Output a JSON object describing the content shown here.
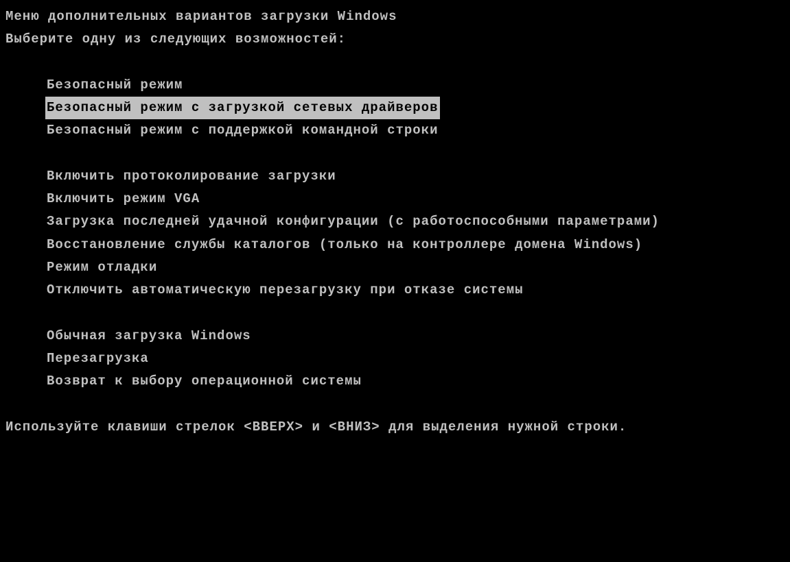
{
  "header": {
    "title": "Меню дополнительных вариантов загрузки Windows",
    "subtitle": "Выберите одну из следующих возможностей:"
  },
  "menu": {
    "group1": [
      {
        "label": "Безопасный режим",
        "selected": false
      },
      {
        "label": "Безопасный режим с загрузкой сетевых драйверов",
        "selected": true
      },
      {
        "label": "Безопасный режим с поддержкой командной строки",
        "selected": false
      }
    ],
    "group2": [
      {
        "label": "Включить протоколирование загрузки",
        "selected": false
      },
      {
        "label": "Включить режим VGA",
        "selected": false
      },
      {
        "label": "Загрузка последней удачной конфигурации (с работоспособными параметрами)",
        "selected": false
      },
      {
        "label": "Восстановление службы каталогов (только на контроллере домена Windows)",
        "selected": false
      },
      {
        "label": "Режим отладки",
        "selected": false
      },
      {
        "label": "Отключить автоматическую перезагрузку при отказе системы",
        "selected": false
      }
    ],
    "group3": [
      {
        "label": "Обычная загрузка Windows",
        "selected": false
      },
      {
        "label": "Перезагрузка",
        "selected": false
      },
      {
        "label": "Возврат к выбору операционной системы",
        "selected": false
      }
    ]
  },
  "footer": {
    "hint": "Используйте клавиши стрелок <ВВЕРХ> и <ВНИЗ> для выделения нужной строки."
  }
}
